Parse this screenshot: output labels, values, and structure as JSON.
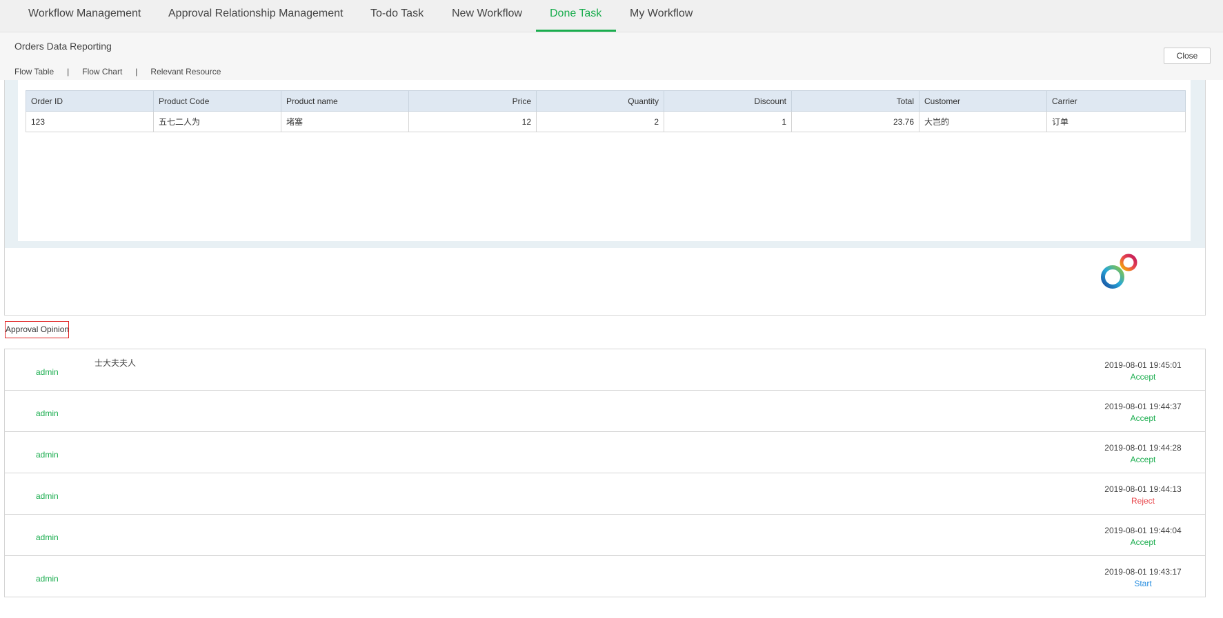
{
  "tabs": [
    {
      "label": "Workflow Management"
    },
    {
      "label": "Approval Relationship Management"
    },
    {
      "label": "To-do Task"
    },
    {
      "label": "New Workflow"
    },
    {
      "label": "Done Task",
      "active": true
    },
    {
      "label": "My Workflow"
    }
  ],
  "header": {
    "title": "Orders Data Reporting",
    "subnav": [
      "Flow Table",
      "Flow Chart",
      "Relevant Resource"
    ],
    "separator": "|",
    "close_label": "Close"
  },
  "order_table": {
    "columns": [
      "Order ID",
      "Product Code",
      "Product name",
      "Price",
      "Quantity",
      "Discount",
      "Total",
      "Customer",
      "Carrier"
    ],
    "rows": [
      [
        "123",
        "五七二人为",
        "堵塞",
        "12",
        "2",
        "1",
        "23.76",
        "大岂的",
        "订单"
      ]
    ]
  },
  "approval": {
    "label": "Approval Opinion",
    "opinions": [
      {
        "user": "admin",
        "comment": "士大夫夫人",
        "time": "2019-08-01 19:45:01",
        "status": "Accept"
      },
      {
        "user": "admin",
        "comment": "",
        "time": "2019-08-01 19:44:37",
        "status": "Accept"
      },
      {
        "user": "admin",
        "comment": "",
        "time": "2019-08-01 19:44:28",
        "status": "Accept"
      },
      {
        "user": "admin",
        "comment": "",
        "time": "2019-08-01 19:44:13",
        "status": "Reject"
      },
      {
        "user": "admin",
        "comment": "",
        "time": "2019-08-01 19:44:04",
        "status": "Accept"
      },
      {
        "user": "admin",
        "comment": "",
        "time": "2019-08-01 19:43:17",
        "status": "Start"
      }
    ]
  },
  "colors": {
    "accent": "#1aad4e",
    "accept": "#1aad4e",
    "reject": "#e8474c",
    "start": "#2a8fe0"
  },
  "icons": {
    "logo": "interlocking-rings-logo"
  }
}
